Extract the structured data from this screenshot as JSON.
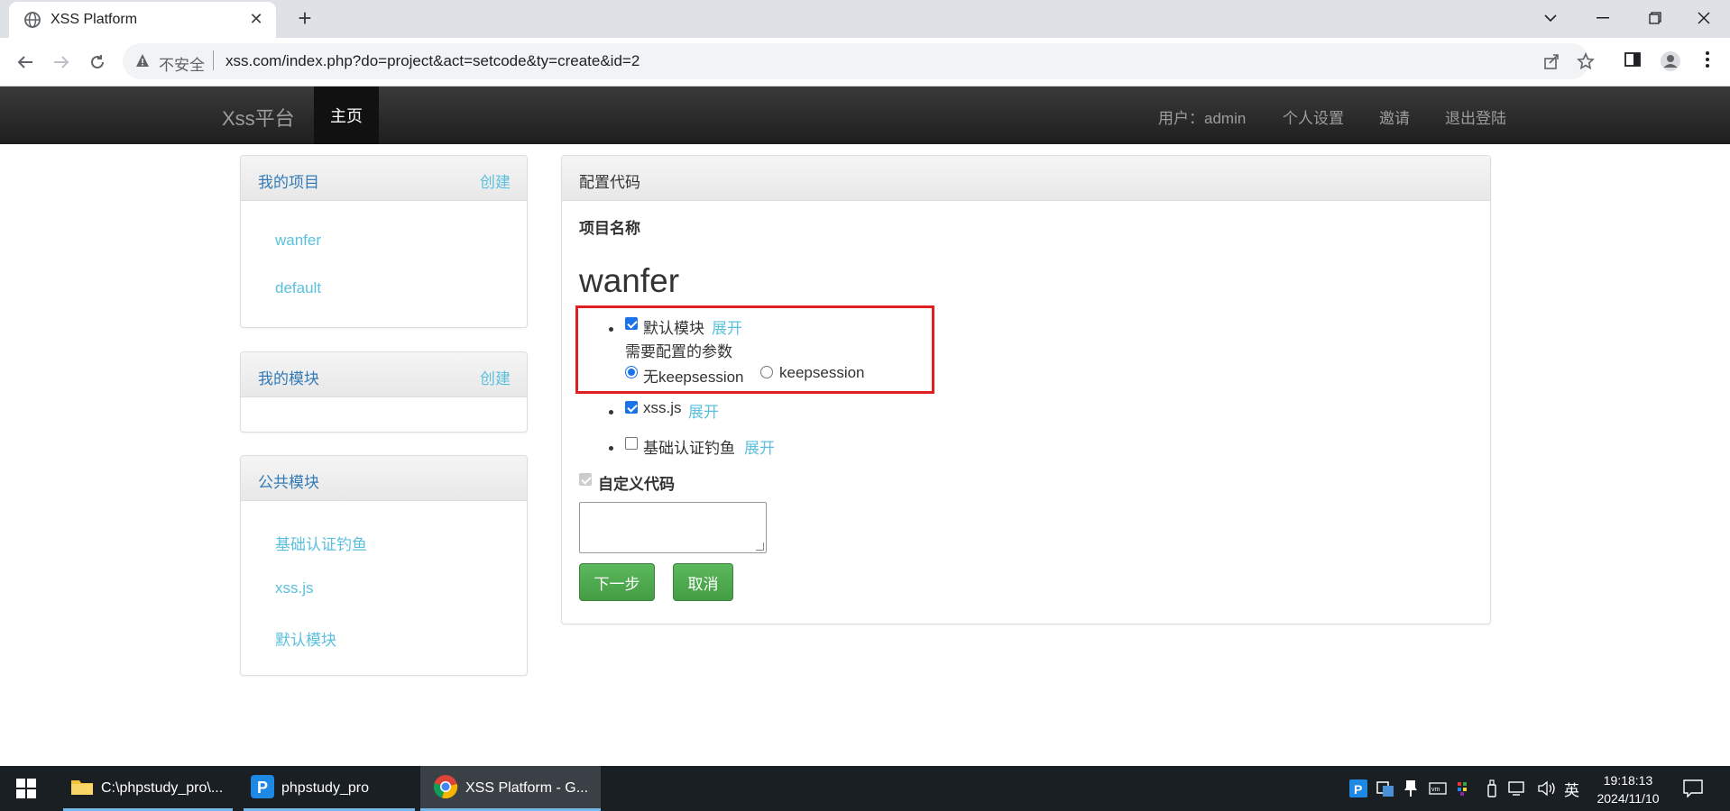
{
  "browser": {
    "tab_title": "XSS Platform",
    "insecure_label": "不安全",
    "url": "xss.com/index.php?do=project&act=setcode&ty=create&id=2"
  },
  "navbar": {
    "brand": "Xss平台",
    "home": "主页",
    "user": "用户：admin",
    "settings": "个人设置",
    "invite": "邀请",
    "logout": "退出登陆"
  },
  "sidebar": {
    "projects": {
      "title": "我的项目",
      "create": "创建",
      "items": [
        "wanfer",
        "default"
      ]
    },
    "modules": {
      "title": "我的模块",
      "create": "创建"
    },
    "public_modules": {
      "title": "公共模块",
      "items": [
        "基础认证钓鱼",
        "xss.js",
        "默认模块"
      ]
    }
  },
  "main": {
    "title": "配置代码",
    "project_label": "项目名称",
    "project_name": "wanfer",
    "modules": [
      {
        "name": "默认模块",
        "checked": true,
        "expand": "展开",
        "params_label": "需要配置的参数",
        "options": [
          "无keepsession",
          "keepsession"
        ]
      },
      {
        "name": "xss.js",
        "checked": true,
        "expand": "展开"
      },
      {
        "name": "基础认证钓鱼",
        "checked": false,
        "expand": "展开"
      }
    ],
    "custom_code_label": "自定义代码",
    "next_button": "下一步",
    "cancel_button": "取消"
  },
  "taskbar": {
    "items": [
      "C:\\phpstudy_pro\\...",
      "phpstudy_pro",
      "XSS Platform - G..."
    ],
    "ime": "英",
    "time": "19:18:13",
    "date": "2024/11/10"
  },
  "colors": {
    "link": "#5bc0de",
    "panel_title": "#337ab7",
    "success": "#5cb85c",
    "highlight_box": "#e02020",
    "navbar_bg": "#222222"
  }
}
